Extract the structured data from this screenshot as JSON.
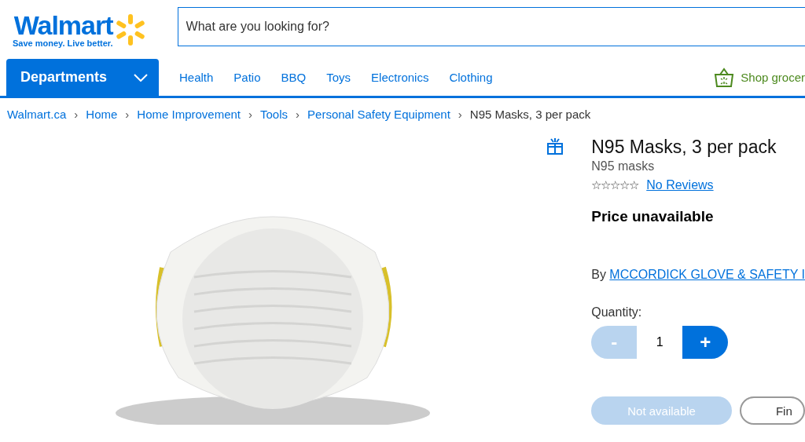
{
  "header": {
    "logo": {
      "name": "Walmart",
      "tagline": "Save money. Live better."
    },
    "search": {
      "placeholder": "What are you looking for?"
    }
  },
  "nav": {
    "departments": "Departments",
    "links": [
      "Health",
      "Patio",
      "BBQ",
      "Toys",
      "Electronics",
      "Clothing"
    ],
    "grocery": "Shop grocer"
  },
  "breadcrumb": {
    "separator": "›",
    "items": [
      "Walmart.ca",
      "Home",
      "Home Improvement",
      "Tools",
      "Personal Safety Equipment",
      "N95 Masks, 3 per pack"
    ]
  },
  "product": {
    "title": "N95 Masks, 3 per pack",
    "subtitle": "N95 masks",
    "stars": 0,
    "reviews": "No Reviews",
    "price": "Price unavailable",
    "by": "By",
    "seller": "MCCORDICK GLOVE & SAFETY I",
    "quantity_label": "Quantity:",
    "quantity": "1",
    "decrement": {
      "label": "-",
      "disabled": true
    },
    "increment": {
      "label": "+",
      "disabled": false
    },
    "buttons": [
      {
        "label": "Not available",
        "kind": "primary",
        "disabled": true
      },
      {
        "label": "Fin",
        "kind": "outline",
        "disabled": false
      }
    ]
  }
}
